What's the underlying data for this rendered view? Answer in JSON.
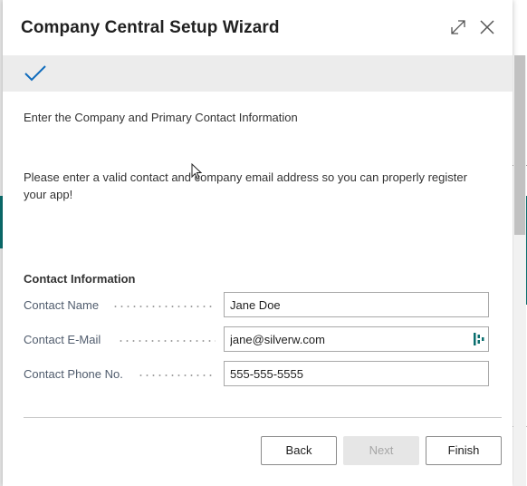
{
  "dialog": {
    "title": "Company Central Setup Wizard"
  },
  "step": {
    "heading": "Enter the Company and Primary Contact Information",
    "intro": "Please enter a valid contact and company email address so you can properly register your app!"
  },
  "contact_section": {
    "title": "Contact Information",
    "fields": [
      {
        "label": "Contact Name",
        "value": "Jane Doe"
      },
      {
        "label": "Contact E-Mail",
        "value": "jane@silverw.com"
      },
      {
        "label": "Contact Phone No.",
        "value": "555-555-5555"
      }
    ]
  },
  "footer": {
    "back_label": "Back",
    "next_label": "Next",
    "finish_label": "Finish"
  },
  "colors": {
    "accent": "#0f6cbd",
    "teal": "#0a6e6e",
    "step_band": "#ececec",
    "label_text": "#505c6d"
  },
  "icons": [
    "expand-icon",
    "close-icon",
    "checkmark-icon",
    "assist-edit-icon",
    "mouse-cursor-icon"
  ]
}
